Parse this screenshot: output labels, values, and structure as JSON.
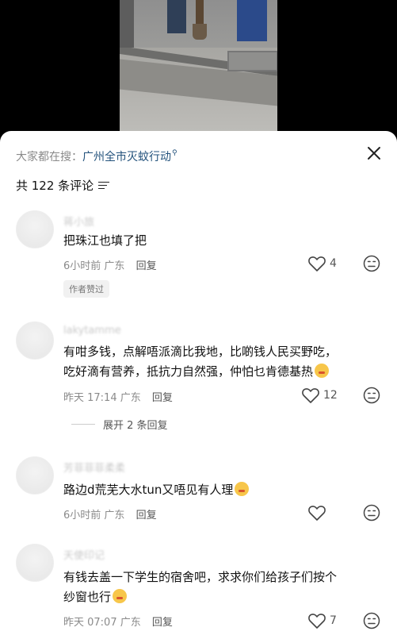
{
  "search": {
    "prefix": "大家都在搜：",
    "keyword": "广州全市灭蚊行动"
  },
  "comments_count": "共 122 条评论",
  "comments": [
    {
      "username": "蒋小旅",
      "text": "把珠江也填了把",
      "time": "6小时前",
      "location": "广东",
      "reply_label": "回复",
      "likes": "4",
      "badge": "作者赞过"
    },
    {
      "username": "lakytamme",
      "text_line1": "有咁多钱，点解唔派滴比我地，比啲钱人民买野吃，",
      "text_line2": "吃好滴有营养，抵抗力自然强，仲怕乜肯德基热",
      "time": "昨天 17:14",
      "location": "广东",
      "reply_label": "回复",
      "likes": "12",
      "expand_label": "展开 2 条回复"
    },
    {
      "username": "芳菲菲菲柔柔",
      "text": "路边d荒芜大水tun又唔见有人理",
      "time": "6小时前",
      "location": "广东",
      "reply_label": "回复",
      "likes": ""
    },
    {
      "username": "天使印记",
      "text_line1": "有钱去盖一下学生的宿舍吧，求求你们给孩子们按个",
      "text_line2": "纱窗也行",
      "time": "昨天 07:07",
      "location": "广东",
      "reply_label": "回复",
      "likes": "7"
    }
  ],
  "icons": {
    "close": "close-icon",
    "sort": "sort-icon",
    "like": "heart-icon",
    "dislike": "dislike-face-icon"
  },
  "colors": {
    "keyword": "#23527c",
    "meta": "#8a8a8a",
    "sheet_bg": "#ffffff"
  }
}
